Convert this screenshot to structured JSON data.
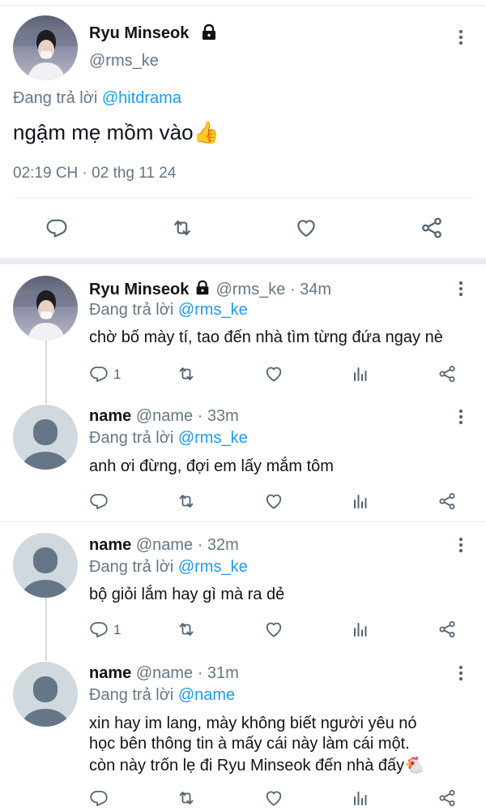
{
  "main_tweet": {
    "display_name": "Ryu Minseok",
    "handle": "@rms_ke",
    "replying_prefix": "Đang trả lời",
    "replying_to": "@hitdrama",
    "text": "ngậm mẹ mồm vào👍",
    "timestamp": "02:19 CH · 02 thg 11 24"
  },
  "replies": [
    {
      "display_name": "Ryu Minseok",
      "handle": "@rms_ke",
      "time": "· 34m",
      "replying_prefix": "Đang trả lời",
      "replying_to": "@rms_ke",
      "text": "chờ bố mày tí, tao đến nhà tìm từng đứa ngay nè",
      "reply_count": "1"
    },
    {
      "display_name": "name",
      "handle": "@name",
      "time": "· 33m",
      "replying_prefix": "Đang trả lời",
      "replying_to": "@rms_ke",
      "text": "anh ơi đừng, đợi em lấy mắm tôm",
      "reply_count": ""
    },
    {
      "display_name": "name",
      "handle": "@name",
      "time": "· 32m",
      "replying_prefix": "Đang trả lời",
      "replying_to": "@rms_ke",
      "text": "bộ giỏi lắm hay gì mà ra dẻ",
      "reply_count": "1"
    },
    {
      "display_name": "name",
      "handle": "@name",
      "time": "· 31m",
      "replying_prefix": "Đang trả lời",
      "replying_to": "@name",
      "text_lines": [
        "xin hay im lang, mày không biết người yêu nó",
        "học bên thông tin à mấy cái này làm cái một.",
        "còn này trốn lẹ đi Ryu Minseok đến nhà đấy🐔"
      ],
      "reply_count": ""
    }
  ],
  "colors": {
    "accent": "#1d9bf0",
    "secondary_text": "#657786",
    "icon": "#536471",
    "divider": "#e6ecf0",
    "default_avatar_bg": "#cfd9de",
    "default_avatar_fg": "#657786"
  }
}
